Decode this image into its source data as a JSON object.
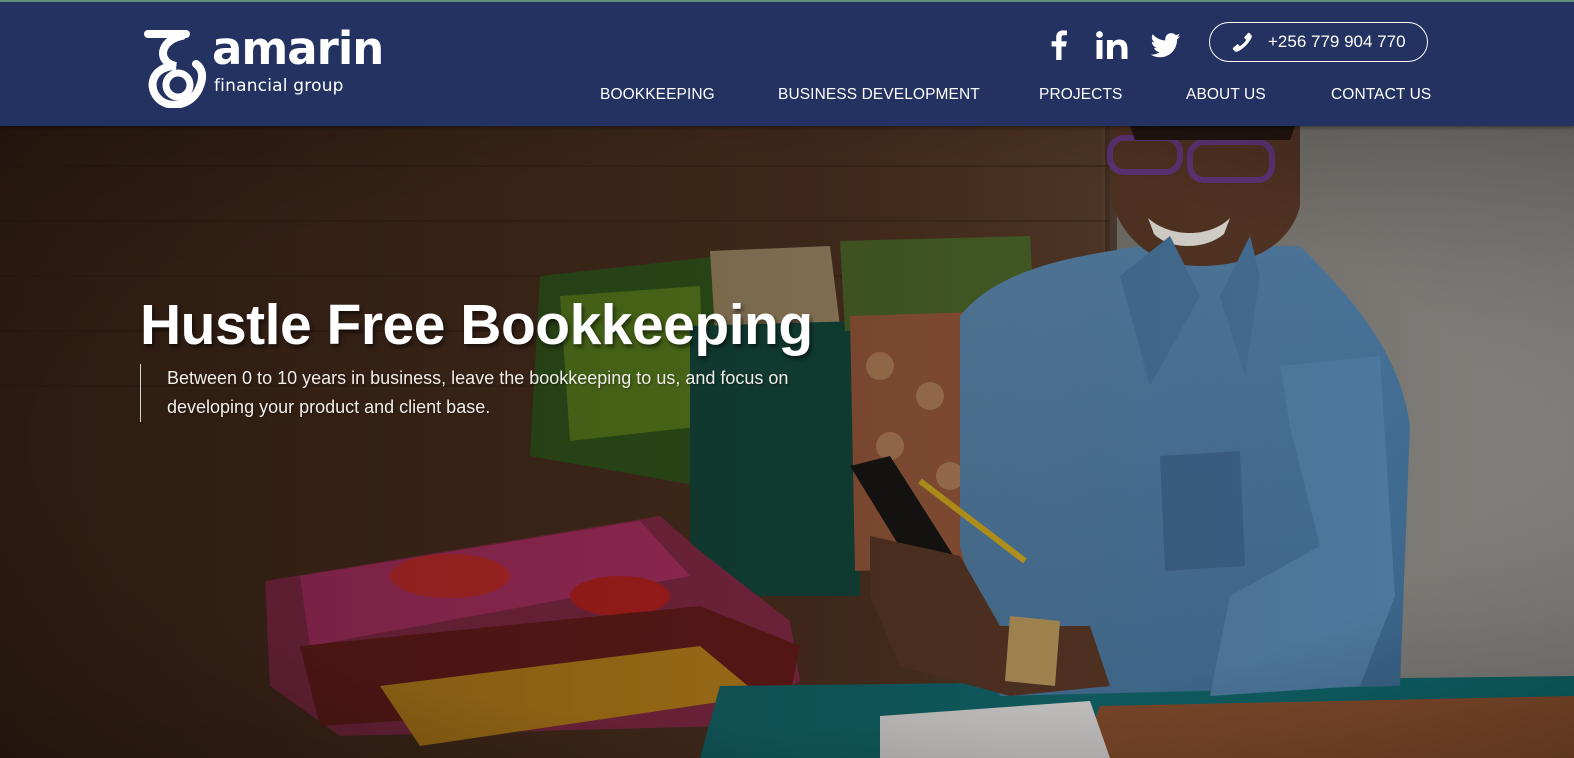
{
  "brand": {
    "name": "amarin",
    "tagline": "financial group"
  },
  "header": {
    "social": [
      {
        "label": "Facebook",
        "icon": "facebook-icon"
      },
      {
        "label": "LinkedIn",
        "icon": "linkedin-icon"
      },
      {
        "label": "Twitter",
        "icon": "twitter-icon"
      }
    ],
    "phone": "+256 779 904 770",
    "nav": [
      {
        "label": "BOOKKEEPING"
      },
      {
        "label": "BUSINESS DEVELOPMENT"
      },
      {
        "label": "PROJECTS"
      },
      {
        "label": "ABOUT US"
      },
      {
        "label": "CONTACT US"
      }
    ]
  },
  "hero": {
    "title": "Hustle Free Bookkeeping",
    "description": "Between 0 to 10 years in business, leave the bookkeeping to us, and focus on developing your product and client base."
  },
  "colors": {
    "header_bg": "#233261",
    "header_top_border": "#5f8e7d",
    "text_light": "#ffffff"
  }
}
